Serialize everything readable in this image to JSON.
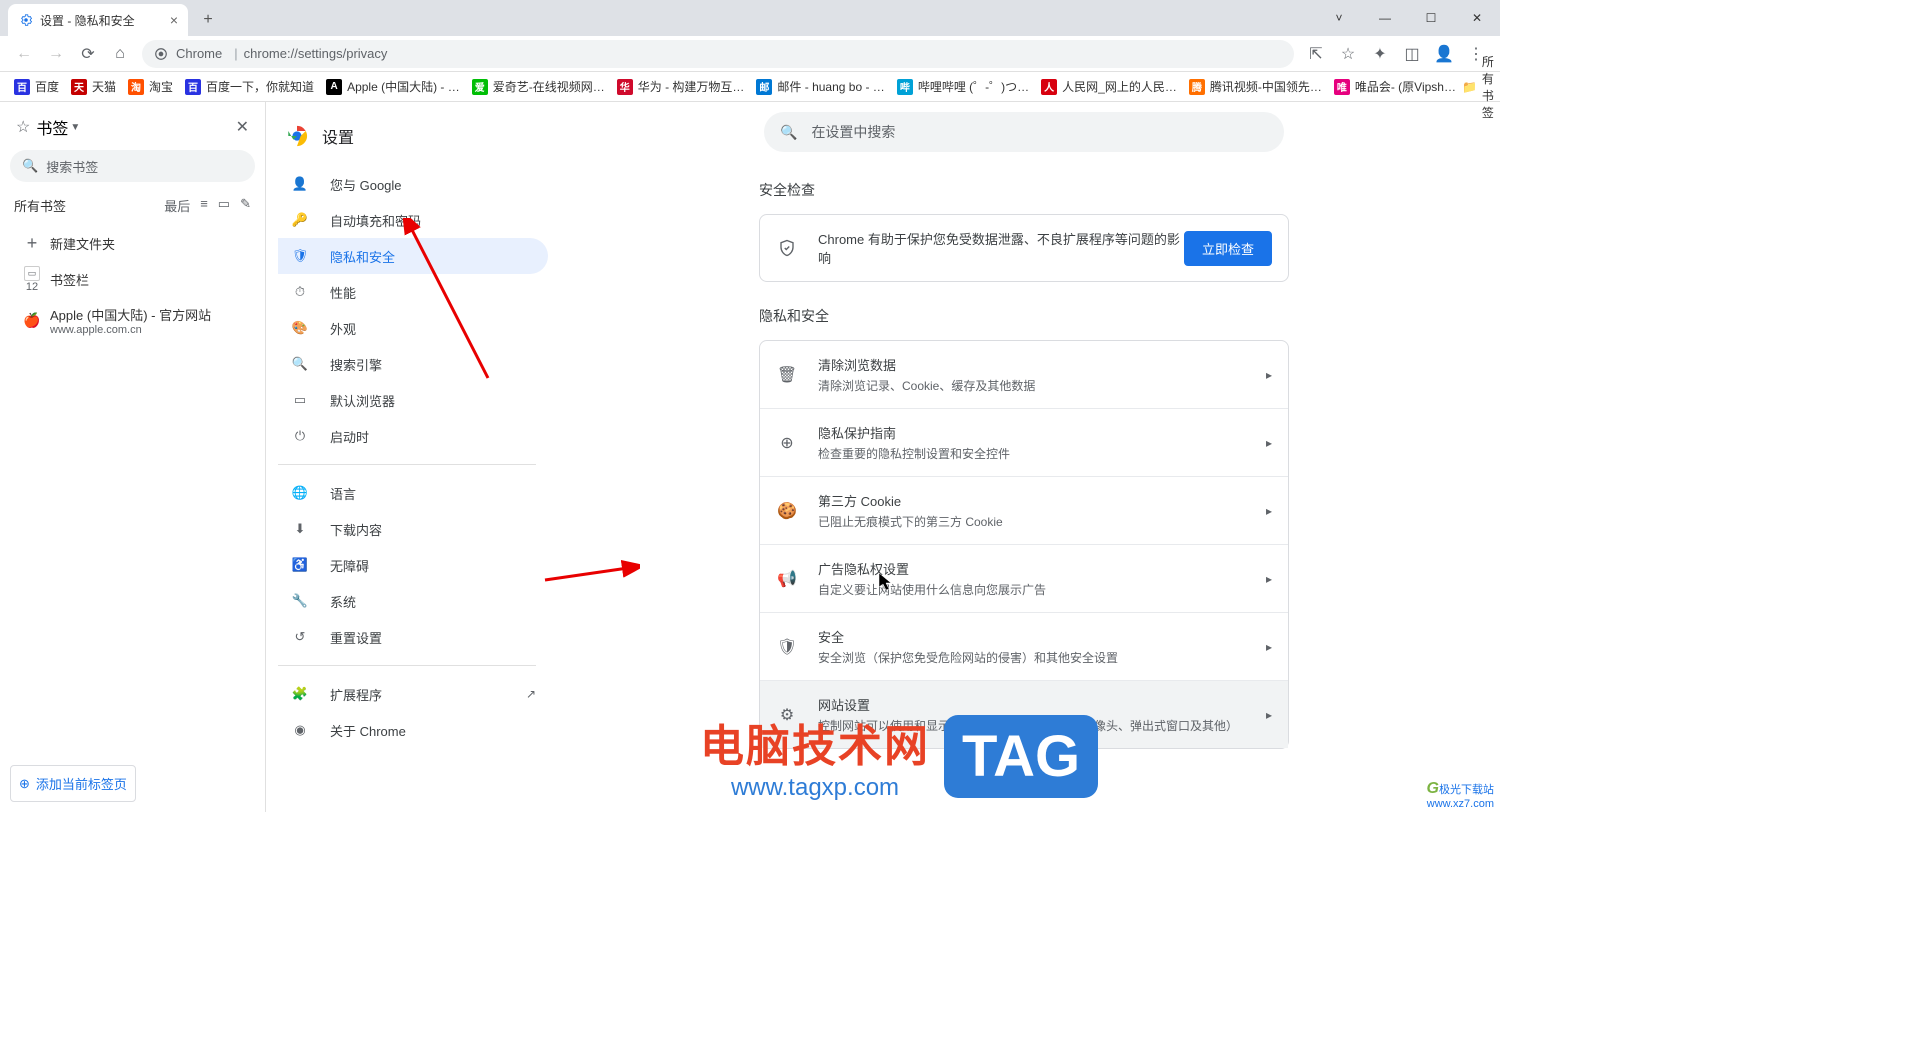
{
  "window": {
    "title": "设置 - 隐私和安全"
  },
  "omnibox": {
    "scheme_label": "Chrome",
    "url": "chrome://settings/privacy"
  },
  "bookmarks_bar": {
    "items": [
      {
        "label": "百度",
        "color": "#2932e1"
      },
      {
        "label": "天猫",
        "color": "#c40000"
      },
      {
        "label": "淘宝",
        "color": "#ff5000"
      },
      {
        "label": "百度一下，你就知道",
        "color": "#2932e1"
      },
      {
        "label": "Apple (中国大陆) - …",
        "color": "#000"
      },
      {
        "label": "爱奇艺-在线视频网…",
        "color": "#00be06"
      },
      {
        "label": "华为 - 构建万物互…",
        "color": "#cf0a2c"
      },
      {
        "label": "邮件 - huang bo - …",
        "color": "#0078d4"
      },
      {
        "label": "哔哩哔哩 (゜-゜)つ…",
        "color": "#00a1d6"
      },
      {
        "label": "人民网_网上的人民…",
        "color": "#d7000f"
      },
      {
        "label": "腾讯视频-中国领先…",
        "color": "#ff6f00"
      },
      {
        "label": "唯品会- (原Vipsh…",
        "color": "#e6007e"
      }
    ],
    "all_label": "所有书签"
  },
  "bm_panel": {
    "header": "书签",
    "search_placeholder": "搜索书签",
    "all_label": "所有书签",
    "recent_label": "最后",
    "entries": [
      {
        "icon": "+",
        "title": "新建文件夹",
        "sub": ""
      },
      {
        "icon_num": "12",
        "title": "书签栏",
        "sub": ""
      },
      {
        "icon": "apple",
        "title": "Apple (中国大陆) - 官方网站",
        "sub": "www.apple.com.cn"
      }
    ],
    "add_current": "添加当前标签页"
  },
  "settings": {
    "title": "设置",
    "search_placeholder": "在设置中搜索",
    "nav": [
      {
        "icon": "person",
        "label": "您与 Google"
      },
      {
        "icon": "autofill",
        "label": "自动填充和密码"
      },
      {
        "icon": "shield",
        "label": "隐私和安全",
        "active": true
      },
      {
        "icon": "speed",
        "label": "性能"
      },
      {
        "icon": "appearance",
        "label": "外观"
      },
      {
        "icon": "search",
        "label": "搜索引擎"
      },
      {
        "icon": "browser",
        "label": "默认浏览器"
      },
      {
        "icon": "power",
        "label": "启动时"
      }
    ],
    "nav2": [
      {
        "icon": "lang",
        "label": "语言"
      },
      {
        "icon": "download",
        "label": "下载内容"
      },
      {
        "icon": "a11y",
        "label": "无障碍"
      },
      {
        "icon": "wrench",
        "label": "系统"
      },
      {
        "icon": "reset",
        "label": "重置设置"
      }
    ],
    "nav3": [
      {
        "icon": "ext",
        "label": "扩展程序",
        "external": true
      },
      {
        "icon": "chrome",
        "label": "关于 Chrome"
      }
    ],
    "safety": {
      "title": "安全检查",
      "desc": "Chrome 有助于保护您免受数据泄露、不良扩展程序等问题的影响",
      "button": "立即检查"
    },
    "privacy": {
      "title": "隐私和安全",
      "rows": [
        {
          "icon": "trash",
          "title": "清除浏览数据",
          "sub": "清除浏览记录、Cookie、缓存及其他数据"
        },
        {
          "icon": "guide",
          "title": "隐私保护指南",
          "sub": "检查重要的隐私控制设置和安全控件"
        },
        {
          "icon": "cookie",
          "title": "第三方 Cookie",
          "sub": "已阻止无痕模式下的第三方 Cookie"
        },
        {
          "icon": "ads",
          "title": "广告隐私权设置",
          "sub": "自定义要让网站使用什么信息向您展示广告"
        },
        {
          "icon": "safe",
          "title": "安全",
          "sub": "安全浏览（保护您免受危险网站的侵害）和其他安全设置"
        },
        {
          "icon": "sliders",
          "title": "网站设置",
          "sub": "控制网站可以使用和显示什么信息（如位置信息、摄像头、弹出式窗口及其他）",
          "hover": true
        }
      ]
    }
  },
  "watermark": {
    "cn": "电脑技术网",
    "url": "www.tagxp.com",
    "tag": "TAG",
    "corner1": "极光下载站",
    "corner2": "www.xz7.com"
  }
}
